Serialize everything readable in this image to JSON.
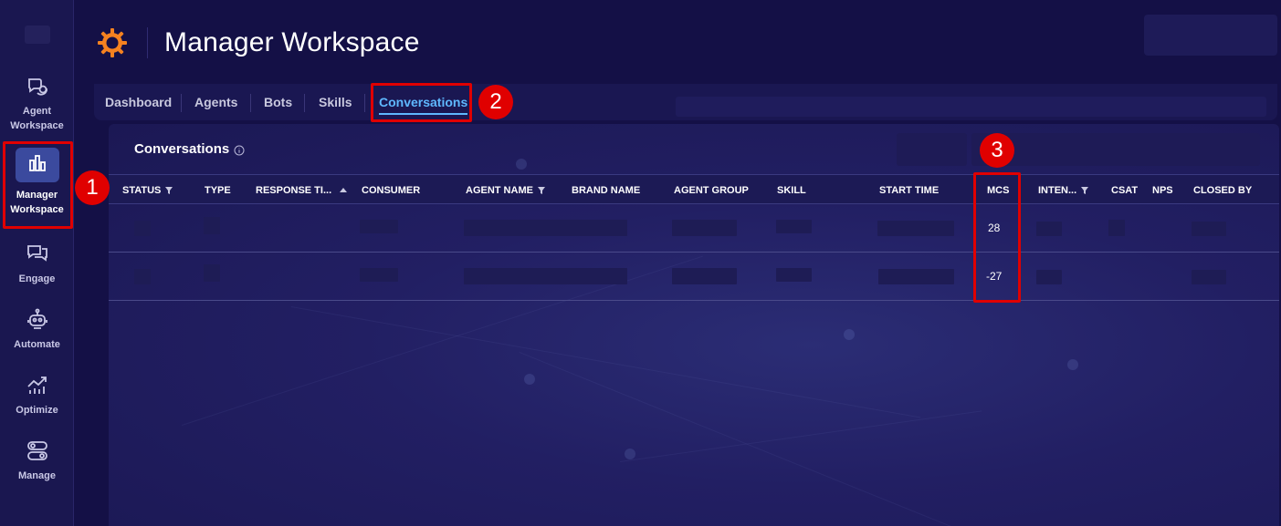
{
  "sidebar": {
    "items": [
      {
        "label_line1": "Agent",
        "label_line2": "Workspace",
        "icon": "headset-chat-icon"
      },
      {
        "label_line1": "Manager",
        "label_line2": "Workspace",
        "icon": "bar-chart-icon",
        "active": true
      },
      {
        "label_line1": "Engage",
        "icon": "chat-bubbles-icon"
      },
      {
        "label_line1": "Automate",
        "icon": "robot-icon"
      },
      {
        "label_line1": "Optimize",
        "icon": "trend-chart-icon"
      },
      {
        "label_line1": "Manage",
        "icon": "toggles-icon"
      }
    ]
  },
  "header": {
    "title": "Manager Workspace",
    "logo_icon": "gear-logo-icon",
    "logo_color": "#f58220"
  },
  "tabs": [
    {
      "label": "Dashboard"
    },
    {
      "label": "Agents"
    },
    {
      "label": "Bots"
    },
    {
      "label": "Skills"
    },
    {
      "label": "Conversations",
      "active": true
    }
  ],
  "panel": {
    "title": "Conversations",
    "info_icon": "info-circle-icon"
  },
  "table": {
    "columns": [
      {
        "label": "STATUS",
        "filter": true
      },
      {
        "label": "TYPE"
      },
      {
        "label": "RESPONSE TI...",
        "sort": "asc"
      },
      {
        "label": "CONSUMER"
      },
      {
        "label": "AGENT NAME",
        "filter": true
      },
      {
        "label": "BRAND NAME"
      },
      {
        "label": "AGENT GROUP"
      },
      {
        "label": "SKILL"
      },
      {
        "label": "START TIME"
      },
      {
        "label": "MCS"
      },
      {
        "label": "INTEN...",
        "filter": true
      },
      {
        "label": "CSAT"
      },
      {
        "label": "NPS"
      },
      {
        "label": "CLOSED BY"
      }
    ],
    "rows": [
      {
        "mcs": "28"
      },
      {
        "mcs": "-27"
      }
    ]
  },
  "annotations": [
    "1",
    "2",
    "3"
  ],
  "colors": {
    "accent_tab": "#5fb8ff",
    "annotation_red": "#e00000",
    "sidebar_active_bg": "#3b4a9e"
  }
}
